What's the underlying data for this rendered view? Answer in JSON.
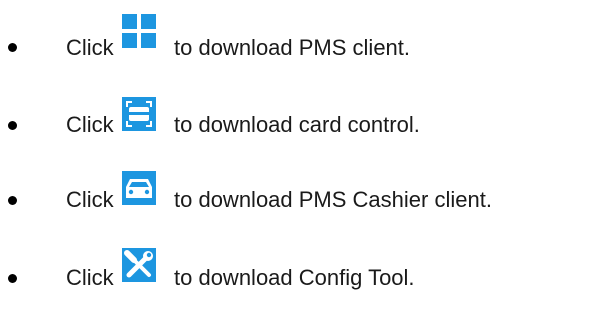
{
  "items": [
    {
      "prefix": "Click",
      "icon": "windows-icon",
      "text": "to download PMS client."
    },
    {
      "prefix": "Click",
      "icon": "card-reader-icon",
      "text": "to download card control."
    },
    {
      "prefix": "Click",
      "icon": "car-icon",
      "text": "to download PMS Cashier client."
    },
    {
      "prefix": "Click",
      "icon": "tools-icon",
      "text": "to download Config Tool."
    }
  ],
  "colors": {
    "icon_bg": "#1d96e0",
    "icon_fg": "#ffffff"
  }
}
